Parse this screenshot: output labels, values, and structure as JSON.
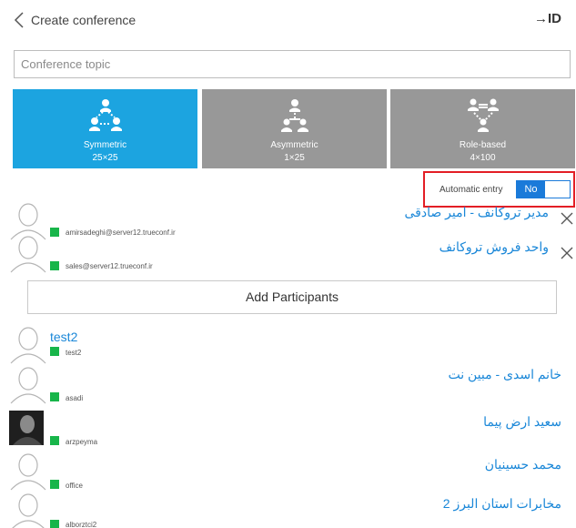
{
  "header": {
    "title": "Create conference",
    "right_label": "→ID",
    "back_icon": "chevron-left-icon"
  },
  "topic": {
    "placeholder": "Conference topic",
    "value": ""
  },
  "conference_types": [
    {
      "label": "Symmetric",
      "count": "25×25",
      "selected": true,
      "color": "#1ca4e0",
      "icon": "symmetric-users-icon"
    },
    {
      "label": "Asymmetric",
      "count": "1×25",
      "selected": false,
      "color": "#989898",
      "icon": "asymmetric-users-icon"
    },
    {
      "label": "Role-based",
      "count": "4×100",
      "selected": false,
      "color": "#989898",
      "icon": "role-based-users-icon"
    }
  ],
  "auto_entry": {
    "label": "Automatic entry",
    "value": "No",
    "highlight_color": "#e31e25",
    "toggle_color": "#1a7ad9"
  },
  "selected_participants": [
    {
      "name": "مدیر تروکانف - امیر صادقی",
      "login": "amirsadeghi@server12.trueconf.ir"
    },
    {
      "name": "واحد فروش تروکانف",
      "login": "sales@server12.trueconf.ir"
    }
  ],
  "add_button": {
    "label": "Add Participants"
  },
  "contacts": [
    {
      "name": "test2",
      "login": "test2"
    },
    {
      "name": "خانم اسدی - مبین نت",
      "login": "asadi"
    },
    {
      "name": "سعید ارض پیما",
      "login": "arzpeyma"
    },
    {
      "name": "محمد حسینیان",
      "login": "office"
    },
    {
      "name": "مخابرات استان البرز 2",
      "login": "alborztci2"
    }
  ],
  "status_color": "#18b54a"
}
